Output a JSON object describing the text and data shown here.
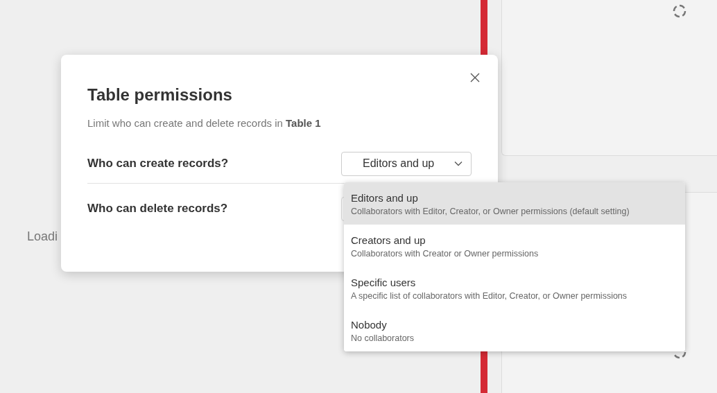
{
  "background": {
    "loading_text": "Loadi"
  },
  "dialog": {
    "title": "Table permissions",
    "subtitle": "Limit who can create and delete records in **Table 1**",
    "rows": [
      {
        "label": "Who can create records?",
        "value": "Editors and up",
        "expanded": true
      },
      {
        "label": "Who can delete records?"
      }
    ]
  },
  "menu": {
    "options": [
      {
        "title": "Editors and up",
        "description": "Collaborators with Editor, Creator, or Owner permissions (default setting)",
        "selected": true
      },
      {
        "title": "Creators and up",
        "description": "Collaborators with Creator or Owner permissions",
        "selected": false
      },
      {
        "title": "Specific users",
        "description": "A specific list of collaborators with Editor, Creator, or Owner permissions",
        "selected": false
      },
      {
        "title": "Nobody",
        "description": "No collaborators",
        "selected": false
      }
    ]
  }
}
